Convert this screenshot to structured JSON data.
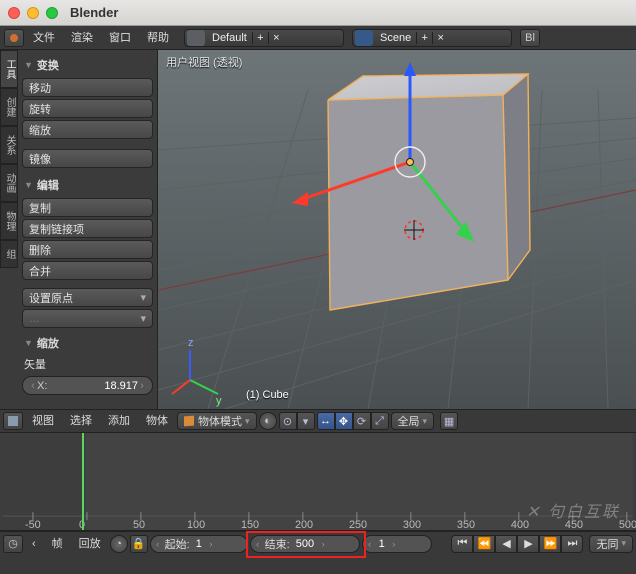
{
  "app": {
    "title": "Blender"
  },
  "top_menu": {
    "file": "文件",
    "render": "渲染",
    "window": "窗口",
    "help": "帮助"
  },
  "layout_sel": "Default",
  "scene_sel": "Scene",
  "bl_short": "Bl",
  "shelf": {
    "tabs": [
      "工具",
      "创建",
      "关系",
      "动画",
      "物理",
      "组"
    ],
    "panel_transform": "变换",
    "panel_edit": "编辑",
    "panel_scale_op": "缩放",
    "btn_move": "移动",
    "btn_rotate": "旋转",
    "btn_scale": "缩放",
    "btn_mirror": "镜像",
    "btn_duplicate": "复制",
    "btn_duplink": "复制链接项",
    "btn_delete": "删除",
    "btn_join": "合并",
    "btn_origin": "设置原点",
    "vector_label": "矢量",
    "x_label": "X:",
    "x_value": "18.917"
  },
  "viewport": {
    "header_label": "用户视图 (透视)",
    "object_name": "(1) Cube"
  },
  "vp_header": {
    "menu_view": "视图",
    "menu_select": "选择",
    "menu_add": "添加",
    "menu_object": "物体",
    "mode": "物体模式",
    "orient": "全局"
  },
  "timeline": {
    "ticks": [
      -50,
      0,
      50,
      100,
      150,
      200,
      250,
      300,
      350,
      400,
      450,
      500
    ],
    "frame_label": "帧",
    "playback": "回放",
    "start_label": "起始:",
    "start_value": "1",
    "end_label": "结束:",
    "end_value": "500",
    "cur_value": "1",
    "nosync": "无同"
  },
  "watermark": "✕ 句白互联"
}
